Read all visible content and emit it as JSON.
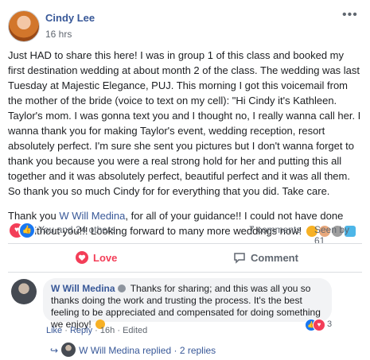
{
  "post": {
    "author": "Cindy Lee",
    "time": "16 hrs",
    "more_icon": "more-horizontal-icon",
    "paragraph1": "Just HAD to share this here! I was in group 1 of this class and booked my first destination wedding at about month 2 of the class. The wedding was last Tuesday at Majestic Elegance, PUJ. This morning I got this voicemail from the mother of the bride (voice to text on my cell): \"Hi Cindy it's Kathleen. Taylor's mom. I was gonna text you and I thought no, I really wanna call her. I wanna thank you for making Taylor's event, wedding reception, resort absolutely perfect. I'm sure she sent you pictures but I don't wanna forget to thank you because you were a real strong hold for her and putting this all together and it was absolutely perfect, beautiful perfect and it was all them. So thank you so much Cindy for for everything that you did. Take care.",
    "paragraph2_before": "Thank you ",
    "paragraph2_link": "W Will Medina",
    "paragraph2_after": ", for all of your guidance!! I could not have done this without you!!! Looking forward to many more weddings now!"
  },
  "reactions": {
    "summary": "You and 24 others",
    "comments": "7 comments",
    "seen": "Seen by 61"
  },
  "actions": {
    "love": "Love",
    "comment": "Comment"
  },
  "comment": {
    "author": "W Will Medina",
    "text": "Thanks for sharing; and this was all you so thanks doing the work and trusting the process. It's the best feeling to be appreciated and compensated for doing something we enjoy!",
    "reaction_count": "3",
    "like": "Like",
    "reply": "Reply",
    "time": "16h",
    "edited": "Edited",
    "dot": "·"
  },
  "replies": {
    "author": "W Will Medina",
    "replied": "replied",
    "dot": "·",
    "count": "2 replies"
  },
  "colors": {
    "link": "#385898",
    "love": "#f33e58",
    "like": "#1877f2",
    "bubble": "#f2f3f5"
  }
}
